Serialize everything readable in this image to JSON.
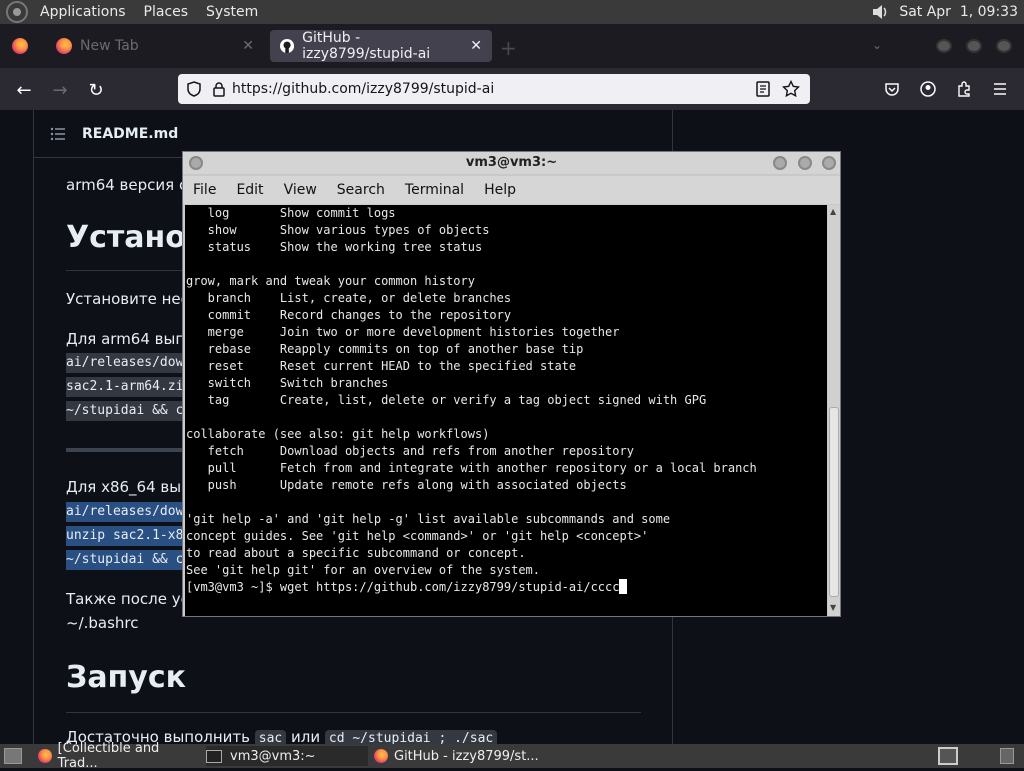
{
  "top_panel": {
    "menus": [
      "Applications",
      "Places",
      "System"
    ],
    "clock": "Sat Apr  1, 09:33",
    "volume_icon": "speaker-icon"
  },
  "browser": {
    "tabs": [
      {
        "label": "",
        "icon": "firefox-icon"
      },
      {
        "label": "New Tab",
        "icon": "firefox-icon"
      },
      {
        "label": "GitHub - izzy8799/stupid-ai",
        "icon": "github-icon",
        "active": true
      }
    ],
    "url": "https://github.com/izzy8799/stupid-ai"
  },
  "readme": {
    "header": "README.md",
    "line1": "arm64 версия со",
    "heading_install": "Установ",
    "install_text": "Установите необ",
    "arm64_text": "Для arm64 выпо",
    "arm64_code": [
      "ai/releases/dow",
      "sac2.1-arm64.zi",
      "~/stupidai && c"
    ],
    "x86_text": "Для x86_64 вып",
    "x86_code": [
      "ai/releases/dow",
      "unzip sac2.1-x8",
      "~/stupidai && c"
    ],
    "also_text": "Также после уст",
    "bashrc": "~/.bashrc",
    "heading_run": "Запуск",
    "run_text_before": "Достаточно выполнить ",
    "run_code1": "sac",
    "run_text_mid": " или ",
    "run_code2": "cd ~/stupidai ; ./sac"
  },
  "terminal": {
    "title": "vm3@vm3:~",
    "menu": [
      "File",
      "Edit",
      "View",
      "Search",
      "Terminal",
      "Help"
    ],
    "lines": [
      "   log       Show commit logs",
      "   show      Show various types of objects",
      "   status    Show the working tree status",
      "",
      "grow, mark and tweak your common history",
      "   branch    List, create, or delete branches",
      "   commit    Record changes to the repository",
      "   merge     Join two or more development histories together",
      "   rebase    Reapply commits on top of another base tip",
      "   reset     Reset current HEAD to the specified state",
      "   switch    Switch branches",
      "   tag       Create, list, delete or verify a tag object signed with GPG",
      "",
      "collaborate (see also: git help workflows)",
      "   fetch     Download objects and refs from another repository",
      "   pull      Fetch from and integrate with another repository or a local branch",
      "   push      Update remote refs along with associated objects",
      "",
      "'git help -a' and 'git help -g' list available subcommands and some",
      "concept guides. See 'git help <command>' or 'git help <concept>'",
      "to read about a specific subcommand or concept.",
      "See 'git help git' for an overview of the system."
    ],
    "prompt_line": "[vm3@vm3 ~]$ wget https://github.com/izzy8799/stupid-ai/cccc"
  },
  "taskbar": {
    "items": [
      {
        "label": "[Collectible and Trad...",
        "icon": "firefox-icon"
      },
      {
        "label": "vm3@vm3:~",
        "icon": "terminal-icon"
      },
      {
        "label": "GitHub - izzy8799/st...",
        "icon": "firefox-icon"
      }
    ]
  }
}
